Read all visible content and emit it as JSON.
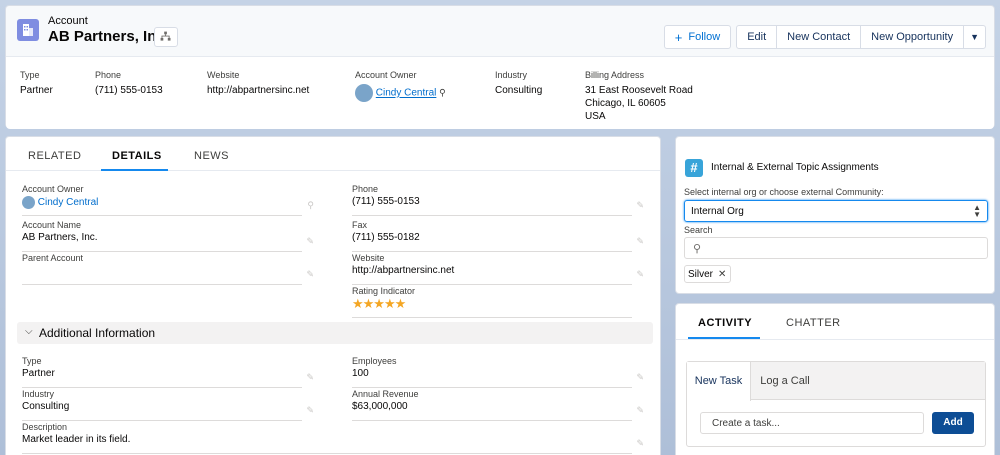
{
  "header": {
    "object_type": "Account",
    "record_name": "AB Partners, Inc.",
    "actions": {
      "follow": "Follow",
      "edit": "Edit",
      "new_contact": "New Contact",
      "new_opportunity": "New Opportunity"
    },
    "fields": [
      {
        "label": "Type",
        "value": "Partner"
      },
      {
        "label": "Phone",
        "value": "(711) 555-0153"
      },
      {
        "label": "Website",
        "value": "http://abpartnersinc.net"
      },
      {
        "label": "Account Owner",
        "value": "Cindy Central"
      },
      {
        "label": "Industry",
        "value": "Consulting"
      },
      {
        "label": "Billing Address",
        "lines": [
          "31 East Roosevelt Road",
          "Chicago, IL 60605",
          "USA"
        ]
      }
    ]
  },
  "tabs": [
    "RELATED",
    "DETAILS",
    "NEWS"
  ],
  "details": {
    "account_owner": {
      "label": "Account Owner",
      "value": "Cindy Central"
    },
    "account_name": {
      "label": "Account Name",
      "value": "AB Partners, Inc."
    },
    "parent_account": {
      "label": "Parent Account",
      "value": ""
    },
    "phone": {
      "label": "Phone",
      "value": "(711) 555-0153"
    },
    "fax": {
      "label": "Fax",
      "value": "(711) 555-0182"
    },
    "website": {
      "label": "Website",
      "value": "http://abpartnersinc.net"
    },
    "rating": {
      "label": "Rating Indicator",
      "stars": "★★★★★",
      "value": 5,
      "max": 5
    },
    "section_title": "Additional Information",
    "type": {
      "label": "Type",
      "value": "Partner"
    },
    "industry": {
      "label": "Industry",
      "value": "Consulting"
    },
    "description": {
      "label": "Description",
      "value": "Market leader in its field."
    },
    "employees": {
      "label": "Employees",
      "value": "100"
    },
    "annual_revenue": {
      "label": "Annual Revenue",
      "value": "$63,000,000"
    }
  },
  "topics": {
    "title": "Internal & External Topic Assignments",
    "select_label": "Select internal org or choose external Community:",
    "select_value": "Internal Org",
    "search_label": "Search",
    "pill": "Silver"
  },
  "activity": {
    "tabs": [
      "ACTIVITY",
      "CHATTER"
    ],
    "composer_tabs": [
      "New Task",
      "Log a Call"
    ],
    "task_placeholder": "Create a task...",
    "add_label": "Add"
  },
  "colors": {
    "brand": "#0070d2",
    "tab_active": "#1589ee",
    "add_button": "#0d4d95",
    "account_icon": "#7f8de1",
    "topic_icon": "#38a4d9",
    "star": "#f4a623"
  }
}
